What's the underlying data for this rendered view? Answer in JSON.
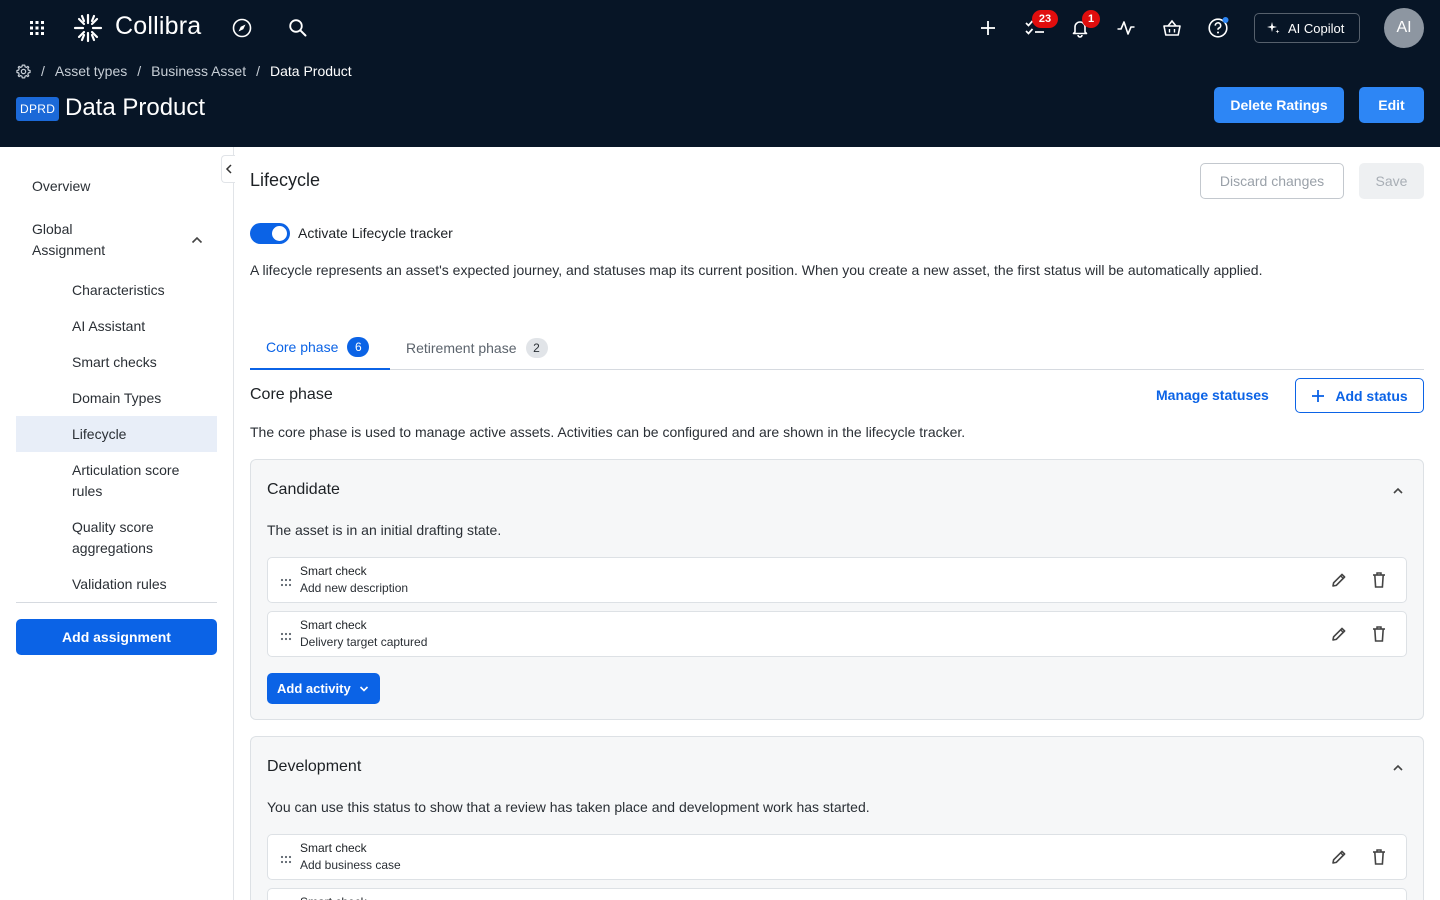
{
  "header": {
    "logo": "Collibra",
    "tasks_badge": "23",
    "notifications_badge": "1",
    "copilot_label": "AI Copilot",
    "avatar_initials": "AI"
  },
  "breadcrumb": {
    "items": [
      "Asset types",
      "Business Asset",
      "Data Product"
    ]
  },
  "page": {
    "code": "DPRD",
    "title": "Data Product",
    "delete_ratings_label": "Delete Ratings",
    "edit_label": "Edit"
  },
  "sidebar": {
    "overview": "Overview",
    "global_assignment_line1": "Global",
    "global_assignment_line2": "Assignment",
    "items": [
      {
        "label": "Characteristics"
      },
      {
        "label": "AI Assistant"
      },
      {
        "label": "Smart checks"
      },
      {
        "label": "Domain Types"
      },
      {
        "label": "Lifecycle"
      },
      {
        "label_line1": "Articulation score",
        "label_line2": "rules"
      },
      {
        "label_line1": "Quality score",
        "label_line2": "aggregations"
      },
      {
        "label": "Validation rules"
      }
    ],
    "add_assignment_label": "Add assignment"
  },
  "main": {
    "title": "Lifecycle",
    "discard_label": "Discard changes",
    "save_label": "Save",
    "toggle_label": "Activate Lifecycle tracker",
    "description": "A lifecycle represents an asset's expected journey, and statuses map its current position. When you create a new asset, the first status will be automatically applied.",
    "tabs": [
      {
        "label": "Core phase",
        "count": "6"
      },
      {
        "label": "Retirement phase",
        "count": "2"
      }
    ],
    "section_title": "Core phase",
    "manage_statuses_label": "Manage statuses",
    "add_status_label": "Add status",
    "section_description": "The core phase is used to manage active assets. Activities can be configured and are shown in the lifecycle tracker.",
    "statuses": [
      {
        "title": "Candidate",
        "description": "The asset is in an initial drafting state.",
        "activities": [
          {
            "type": "Smart check",
            "name": "Add new description"
          },
          {
            "type": "Smart check",
            "name": "Delivery target captured"
          }
        ],
        "add_activity_label": "Add activity"
      },
      {
        "title": "Development",
        "description": "You can use this status to show that a review has taken place and development work has started.",
        "activities": [
          {
            "type": "Smart check",
            "name": "Add business case"
          },
          {
            "type": "Smart check",
            "name": ""
          }
        ]
      }
    ]
  },
  "colors": {
    "header_bg": "#071526",
    "accent": "#0b63e6",
    "header_button": "#2d86f5",
    "badge": "#e00d0d"
  }
}
